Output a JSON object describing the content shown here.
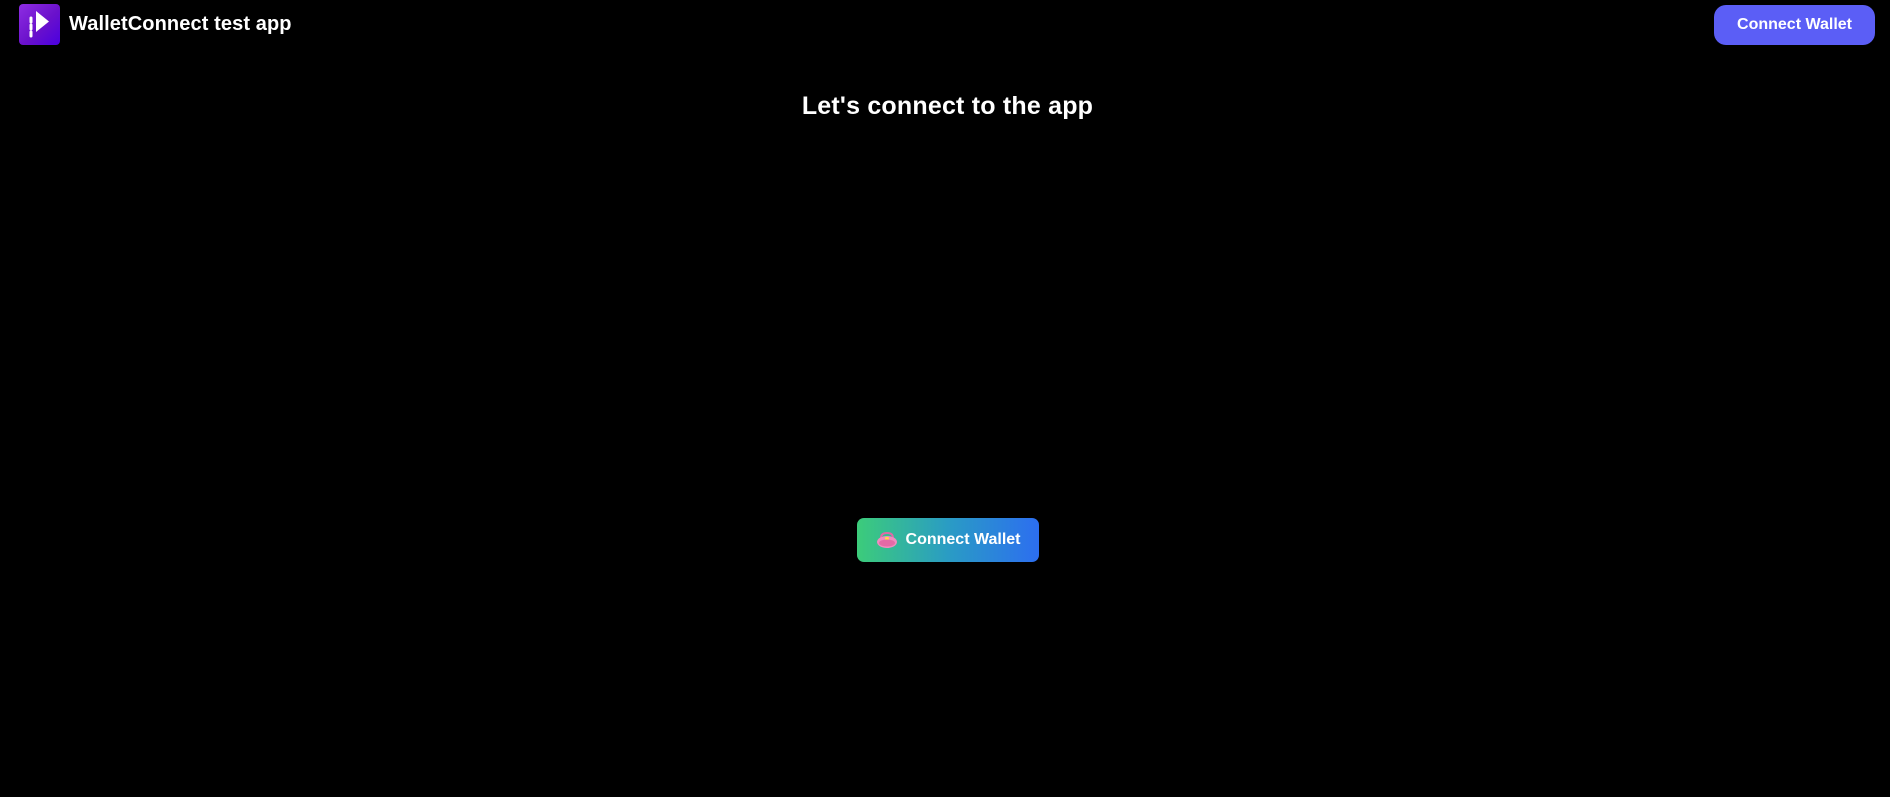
{
  "header": {
    "logo_icon": "walletconnect-play-logo-icon",
    "app_title": "WalletConnect test app",
    "connect_label": "Connect Wallet"
  },
  "main": {
    "headline": "Let's connect to the app",
    "connect_button": {
      "icon": "purse-icon",
      "label": "Connect Wallet"
    }
  },
  "colors": {
    "background": "#000000",
    "header_button": "#5b5ef6",
    "gradient_start": "#3ccc7a",
    "gradient_end": "#2c6ef0",
    "logo": "#7b1fe0"
  }
}
